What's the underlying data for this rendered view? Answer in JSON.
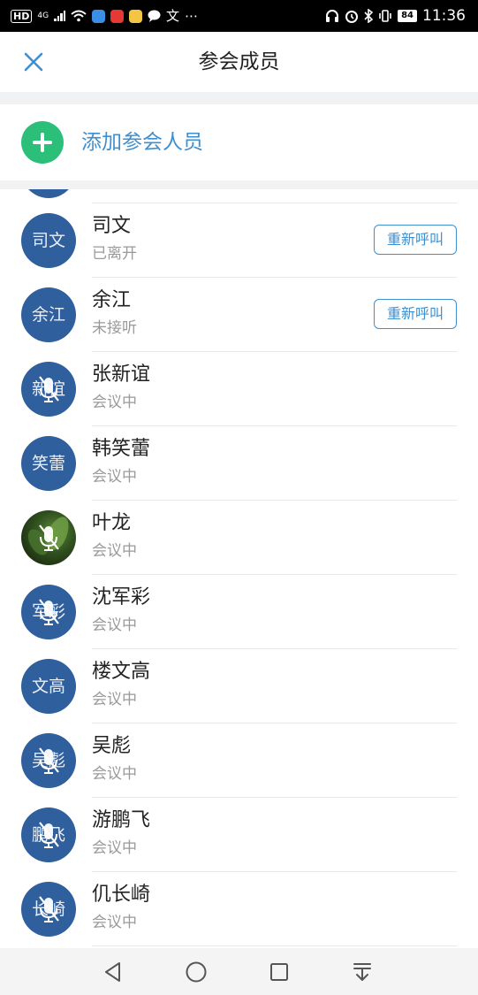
{
  "status_bar": {
    "hd": "HD",
    "network": "4G",
    "more": "⋯",
    "battery": "84",
    "time": "11:36"
  },
  "header": {
    "title": "参会成员"
  },
  "add_member": {
    "label": "添加参会人员"
  },
  "members": [
    {
      "avatar_text": "司文",
      "name": "司文",
      "status": "已离开",
      "muted": false,
      "photo": false,
      "recall_label": "重新呼叫"
    },
    {
      "avatar_text": "余江",
      "name": "余江",
      "status": "未接听",
      "muted": false,
      "photo": false,
      "recall_label": "重新呼叫"
    },
    {
      "avatar_text": "新谊",
      "name": "张新谊",
      "status": "会议中",
      "muted": true,
      "photo": false
    },
    {
      "avatar_text": "笑蕾",
      "name": "韩笑蕾",
      "status": "会议中",
      "muted": false,
      "photo": false
    },
    {
      "avatar_text": "",
      "name": "叶龙",
      "status": "会议中",
      "muted": true,
      "photo": true
    },
    {
      "avatar_text": "军彩",
      "name": "沈军彩",
      "status": "会议中",
      "muted": true,
      "photo": false
    },
    {
      "avatar_text": "文高",
      "name": "楼文高",
      "status": "会议中",
      "muted": false,
      "photo": false
    },
    {
      "avatar_text": "吴彪",
      "name": "吴彪",
      "status": "会议中",
      "muted": true,
      "photo": false
    },
    {
      "avatar_text": "鹏飞",
      "name": "游鹏飞",
      "status": "会议中",
      "muted": true,
      "photo": false
    },
    {
      "avatar_text": "长崎",
      "name": "仉长崎",
      "status": "会议中",
      "muted": true,
      "photo": false
    }
  ],
  "colors": {
    "accent": "#3f8fcf",
    "add_green": "#2bbf7a",
    "avatar_blue": "#2f5f9d",
    "status_gray": "#9a9a9a"
  },
  "icons": {
    "close": "close-icon",
    "add": "plus-circle-icon",
    "muted": "mic-muted-icon",
    "nav": [
      "back-triangle-icon",
      "home-circle-icon",
      "recents-square-icon",
      "notification-pull-icon"
    ]
  }
}
